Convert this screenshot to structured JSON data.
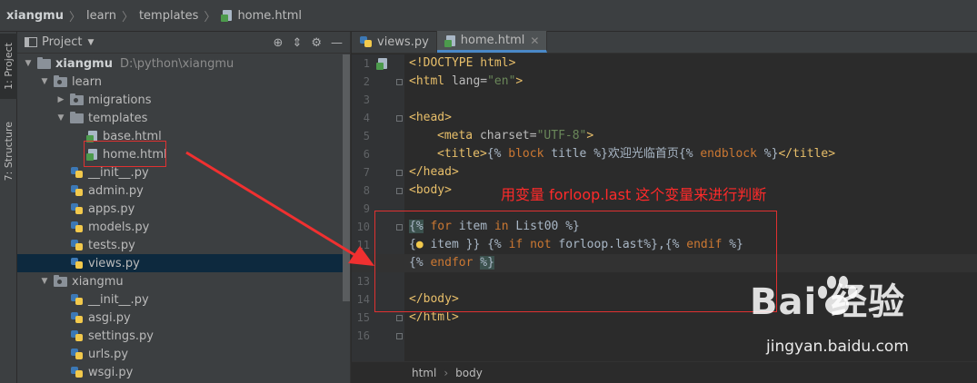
{
  "navbar": {
    "crumbs": [
      "xiangmu",
      "learn",
      "templates",
      "home.html"
    ]
  },
  "leftstrip": {
    "project_tab": "1: Project",
    "structure_tab": "7: Structure"
  },
  "project_panel": {
    "title": "Project",
    "root": {
      "name": "xiangmu",
      "path": "D:\\python\\xiangmu"
    },
    "tree": [
      {
        "label": "learn",
        "kind": "folder",
        "expanded": true
      },
      {
        "label": "migrations",
        "kind": "folder",
        "expanded": false
      },
      {
        "label": "templates",
        "kind": "folder",
        "expanded": true
      },
      {
        "label": "base.html",
        "kind": "html"
      },
      {
        "label": "home.html",
        "kind": "html"
      },
      {
        "label": "__init__.py",
        "kind": "py"
      },
      {
        "label": "admin.py",
        "kind": "py"
      },
      {
        "label": "apps.py",
        "kind": "py"
      },
      {
        "label": "models.py",
        "kind": "py"
      },
      {
        "label": "tests.py",
        "kind": "py"
      },
      {
        "label": "views.py",
        "kind": "py",
        "selected": true
      },
      {
        "label": "xiangmu",
        "kind": "folder",
        "expanded": true
      },
      {
        "label": "__init__.py",
        "kind": "py"
      },
      {
        "label": "asgi.py",
        "kind": "py"
      },
      {
        "label": "settings.py",
        "kind": "py"
      },
      {
        "label": "urls.py",
        "kind": "py"
      },
      {
        "label": "wsgi.py",
        "kind": "py"
      }
    ]
  },
  "editor": {
    "tabs": [
      {
        "label": "views.py",
        "active": false
      },
      {
        "label": "home.html",
        "active": true
      }
    ],
    "line_numbers": [
      "1",
      "2",
      "3",
      "4",
      "5",
      "6",
      "7",
      "8",
      "9",
      "10",
      "11",
      "12",
      "13",
      "14",
      "15",
      "16"
    ],
    "code": {
      "l1": "<!DOCTYPE html>",
      "l2_tag": "<html ",
      "l2_attr": "lang=",
      "l2_str": "\"en\"",
      "l2_end": ">",
      "l4": "<head>",
      "l5_tag": "<meta ",
      "l5_attr": "charset=",
      "l5_str": "\"UTF-8\"",
      "l5_end": ">",
      "l6_open": "<title>",
      "l6_t1": "{% ",
      "l6_kw1": "block",
      "l6_t2": " title %}欢迎光临首页{% ",
      "l6_kw2": "endblock",
      "l6_t3": " %}",
      "l6_close": "</title>",
      "l7": "</head>",
      "l8": "<body>",
      "l10_open": "{%",
      "l10_kw1": " for",
      "l10_t1": " item ",
      "l10_kw2": "in",
      "l10_t2": " List00 %}",
      "l11_a": "{",
      "l11_b": " item }} {% ",
      "l11_kw1": "if",
      "l11_c": " ",
      "l11_kw2": "not",
      "l11_d": " forloop.last%},{% ",
      "l11_kw3": "endif",
      "l11_e": " %}",
      "l12_a": "{% ",
      "l12_kw": "endfor",
      "l12_close": "%}",
      "l14": "</body>",
      "l15": "</html>"
    },
    "bottom_crumbs": [
      "html",
      "body"
    ]
  },
  "annotation": "用变量 forloop.last 这个变量来进行判断",
  "watermark": {
    "logo": "Bai  经验",
    "url": "jingyan.baidu.com"
  },
  "colors": {
    "annotation_red": "#e03131",
    "keyword": "#cc7832",
    "tag": "#e8bf6a",
    "string": "#6a8759"
  }
}
